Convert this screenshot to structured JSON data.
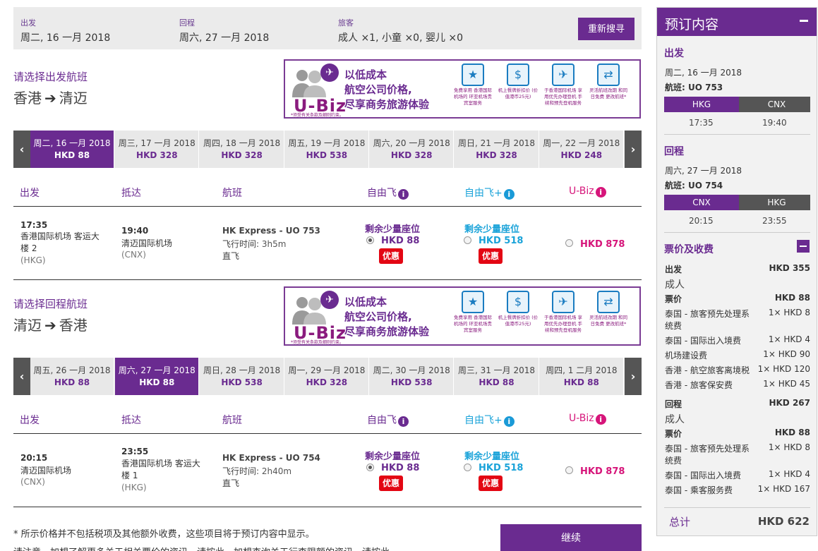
{
  "search": {
    "depart_label": "出发",
    "depart_value": "周二, 16 一月 2018",
    "return_label": "回程",
    "return_value": "周六, 27 一月 2018",
    "pax_label": "旅客",
    "pax_value": "成人 ×1, 小童 ×0, 婴儿 ×0",
    "research_button": "重新搜寻"
  },
  "banner": {
    "logo": "U-Biz",
    "headline": [
      "以低成本",
      "航空公司价格,",
      "尽享商务旅游体验"
    ],
    "note": "*须受有关条款及细则约束。",
    "features": [
      {
        "icon": "star-person-icon",
        "glyph": "★",
        "caption": "免费享用 香港国际机场的 环亚机场贵宾室服务"
      },
      {
        "icon": "money-icon",
        "glyph": "$",
        "caption": "机上餐牌折扣价 (价值港币25元)"
      },
      {
        "icon": "priority-checkin-icon",
        "glyph": "✈",
        "caption": "于香港国际机场 享用优先办理登机 手续和预先登机服务"
      },
      {
        "icon": "change-flight-icon",
        "glyph": "⇄",
        "caption": "灵活航班改期 和同日免费 更改航班*"
      }
    ]
  },
  "outbound": {
    "section_title": "请选择出发航班",
    "from": "香港",
    "to": "清迈",
    "dates": [
      {
        "day": "周二, 16 一月 2018",
        "price": "HKD 88",
        "selected": true
      },
      {
        "day": "周三, 17 一月 2018",
        "price": "HKD 328"
      },
      {
        "day": "周四, 18 一月 2018",
        "price": "HKD 328"
      },
      {
        "day": "周五, 19 一月 2018",
        "price": "HKD 538"
      },
      {
        "day": "周六, 20 一月 2018",
        "price": "HKD 328"
      },
      {
        "day": "周日, 21 一月 2018",
        "price": "HKD 328"
      },
      {
        "day": "周一, 22 一月 2018",
        "price": "HKD 248"
      }
    ],
    "flight": {
      "dep_time": "17:35",
      "dep_airport": "香港国际机场 客运大",
      "dep_airport2": "楼 2",
      "dep_code": "(HKG)",
      "arr_time": "19:40",
      "arr_airport": "清迈国际机场",
      "arr_code": "(CNX)",
      "name": "HK Express - UO 753",
      "duration_label": "飞行时间: ",
      "duration": "3h5m",
      "stops": "直飞",
      "fare1_note": "剩余少量座位",
      "fare1_price": "HKD 88",
      "fare1_promo": "优惠",
      "fare2_note": "剩余少量座位",
      "fare2_price": "HKD 518",
      "fare2_promo": "优惠",
      "fare3_price": "HKD 878"
    }
  },
  "inbound": {
    "section_title": "请选择回程航班",
    "from": "清迈",
    "to": "香港",
    "dates": [
      {
        "day": "周五, 26 一月 2018",
        "price": "HKD 88"
      },
      {
        "day": "周六, 27 一月 2018",
        "price": "HKD 88",
        "selected": true
      },
      {
        "day": "周日, 28 一月 2018",
        "price": "HKD 538"
      },
      {
        "day": "周一, 29 一月 2018",
        "price": "HKD 328"
      },
      {
        "day": "周二, 30 一月 2018",
        "price": "HKD 538"
      },
      {
        "day": "周三, 31 一月 2018",
        "price": "HKD 88"
      },
      {
        "day": "周四, 1 二月 2018",
        "price": "HKD 88"
      }
    ],
    "flight": {
      "dep_time": "20:15",
      "dep_airport": "清迈国际机场",
      "dep_code": "(CNX)",
      "arr_time": "23:55",
      "arr_airport": "香港国际机场 客运大",
      "arr_airport2": "楼 1",
      "arr_code": "(HKG)",
      "name": "HK Express - UO 754",
      "duration_label": "飞行时间: ",
      "duration": "2h40m",
      "stops": "直飞",
      "fare1_note": "剩余少量座位",
      "fare1_price": "HKD 88",
      "fare1_promo": "优惠",
      "fare2_note": "剩余少量座位",
      "fare2_price": "HKD 518",
      "fare2_promo": "优惠",
      "fare3_price": "HKD 878"
    }
  },
  "columns": {
    "depart": "出发",
    "arrive": "抵达",
    "flight": "航班",
    "fare1": "自由飞",
    "fare2": "自由飞+",
    "fare3": "U-Biz"
  },
  "footer": {
    "note": "* 所示价格并不包括税项及其他额外收费，这些项目将于预订内容中显示。",
    "note2": "请注意，加想了解更多关于相关票价的资讯，请按此。加想查询关于行李限额的资讯，请按此。",
    "continue": "继续"
  },
  "summary": {
    "title": "预订内容",
    "out_title": "出发",
    "out_date": "周二, 16 一月 2018",
    "out_flight": "航班: UO 753",
    "out_from": "HKG",
    "out_to": "CNX",
    "out_dep": "17:35",
    "out_arr": "19:40",
    "ret_title": "回程",
    "ret_date": "周六, 27 一月 2018",
    "ret_flight": "航班: UO 754",
    "ret_from": "CNX",
    "ret_to": "HKG",
    "ret_dep": "20:15",
    "ret_arr": "23:55",
    "fees_title": "票价及收费",
    "out_fees_label": "出发",
    "out_fees_total": "HKD 355",
    "out_pax": "成人",
    "out_fare_label": "票价",
    "out_fare": "HKD 88",
    "out_items": [
      {
        "name": "泰国 - 旅客预先处理系",
        "name2": "统费",
        "amount": "1× HKD 8"
      },
      {
        "name": "泰国 - 国际出入境费",
        "amount": "1× HKD 4"
      },
      {
        "name": "机场建设费",
        "amount": "1× HKD 90"
      },
      {
        "name": "香港 - 航空旅客离境税",
        "amount": "1× HKD 120"
      },
      {
        "name": "香港 - 旅客保安费",
        "amount": "1× HKD 45"
      }
    ],
    "ret_fees_label": "回程",
    "ret_fees_total": "HKD 267",
    "ret_pax": "成人",
    "ret_fare_label": "票价",
    "ret_fare": "HKD 88",
    "ret_items": [
      {
        "name": "泰国 - 旅客预先处理系",
        "name2": "统费",
        "amount": "1× HKD 8"
      },
      {
        "name": "泰国 - 国际出入境费",
        "amount": "1× HKD 4"
      },
      {
        "name": "泰国 - 乘客服务费",
        "amount": "1× HKD 167"
      }
    ],
    "total_label": "总计",
    "total_value": "HKD 622"
  },
  "colors": {
    "brand_purple": "#6a2b90",
    "flex_blue": "#1aa3d9",
    "ubiz_magenta": "#d6157a",
    "promo_red": "#e30613"
  }
}
